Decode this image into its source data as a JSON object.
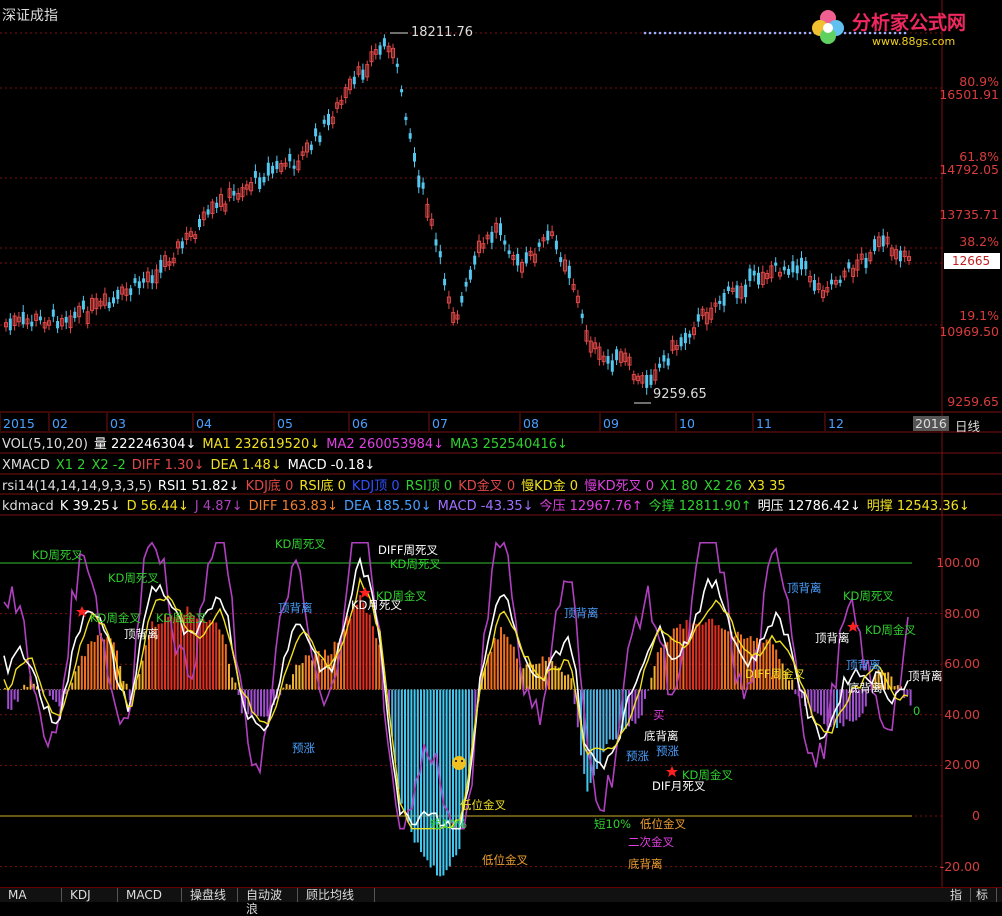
{
  "title": "深证成指",
  "logo": {
    "brand": "分析家公式网",
    "url_text": "www.88gs.com"
  },
  "colors": {
    "up": "#e04848",
    "down": "#55c8f0",
    "grid": "#7a1010",
    "axis_text": "#d83c3c",
    "date_text": "#4aa0ff",
    "white": "#ffffff",
    "yellow": "#f0e020",
    "magenta": "#b040c0",
    "green": "#30c030"
  },
  "price_axis": [
    "80.9%",
    "16501.91",
    "61.8%",
    "14792.05",
    "13735.71",
    "38.2%",
    "12679.5",
    "19.1%",
    "10969.50",
    "9259.65"
  ],
  "price_marker": "12665",
  "high_label": "18211.76",
  "low_label": "9259.65",
  "dates": [
    "2015",
    "02",
    "03",
    "04",
    "05",
    "06",
    "07",
    "08",
    "09",
    "10",
    "11",
    "12",
    "2016",
    "日线"
  ],
  "indicators": {
    "vol": [
      {
        "t": "VOL(5,10,20)",
        "c": "#dddddd"
      },
      {
        "t": "量 222246304↓",
        "c": "#ffffff"
      },
      {
        "t": "MA1 232619520↓",
        "c": "#f0e020"
      },
      {
        "t": "MA2 260053984↓",
        "c": "#e040e0"
      },
      {
        "t": "MA3 252540416↓",
        "c": "#30d030"
      }
    ],
    "xmacd": [
      {
        "t": "XMACD",
        "c": "#dddddd"
      },
      {
        "t": "X1 2",
        "c": "#30d030"
      },
      {
        "t": "X2 -2",
        "c": "#30d030"
      },
      {
        "t": "DIFF 1.30↓",
        "c": "#e04848"
      },
      {
        "t": "DEA 1.48↓",
        "c": "#f0e020"
      },
      {
        "t": "MACD -0.18↓",
        "c": "#ffffff"
      }
    ],
    "rsi": [
      {
        "t": "rsi14(14,14,14,9,3,3,5)",
        "c": "#dddddd"
      },
      {
        "t": "RSI1 51.82↓",
        "c": "#ffffff"
      },
      {
        "t": "KDJ底 0",
        "c": "#e04848"
      },
      {
        "t": "RSI底 0",
        "c": "#f0e020"
      },
      {
        "t": "KDJ顶 0",
        "c": "#3050ff"
      },
      {
        "t": "RSI顶 0",
        "c": "#30d030"
      },
      {
        "t": "KD金叉 0",
        "c": "#e04848"
      },
      {
        "t": "慢KD金 0",
        "c": "#f0e020"
      },
      {
        "t": "慢KD死叉 0",
        "c": "#e040e0"
      },
      {
        "t": "X1 80",
        "c": "#30d030"
      },
      {
        "t": "X2 26",
        "c": "#30d030"
      },
      {
        "t": "X3 35",
        "c": "#f0e020"
      }
    ],
    "kdmacd": [
      {
        "t": "kdmacd",
        "c": "#dddddd"
      },
      {
        "t": "K 39.25↓",
        "c": "#ffffff"
      },
      {
        "t": "D 56.44↓",
        "c": "#f0e020"
      },
      {
        "t": "J 4.87↓",
        "c": "#b040c0"
      },
      {
        "t": "DIFF 163.83↓",
        "c": "#f08030"
      },
      {
        "t": "DEA 185.50↓",
        "c": "#4aa0ff"
      },
      {
        "t": "MACD -43.35↓",
        "c": "#a070ff"
      },
      {
        "t": "今压 12967.76↑",
        "c": "#e040e0"
      },
      {
        "t": "今撑 12811.90↑",
        "c": "#30d030"
      },
      {
        "t": "明压 12786.42↓",
        "c": "#ffffff"
      },
      {
        "t": "明撑 12543.36↓",
        "c": "#f0e020"
      }
    ]
  },
  "osc_axis": [
    "100.00",
    "80.00",
    "60.00",
    "40.00",
    "20.00",
    "0",
    "-20.00"
  ],
  "annotations": [
    {
      "t": "KD周死叉",
      "c": "#30d030"
    },
    {
      "t": "KD周死叉",
      "c": "#30d030"
    },
    {
      "t": "KD周死叉",
      "c": "#30d030"
    },
    {
      "t": "DIFF周死叉",
      "c": "#ffffff"
    },
    {
      "t": "KD周死叉",
      "c": "#30d030"
    },
    {
      "t": "KD周金叉",
      "c": "#30d030"
    },
    {
      "t": "KD周金叉",
      "c": "#30d030"
    },
    {
      "t": "顶背离",
      "c": "#ffffff"
    },
    {
      "t": "顶背离",
      "c": "#4aa0ff"
    },
    {
      "t": "KD月死叉",
      "c": "#ffffff"
    },
    {
      "t": "KD周金叉",
      "c": "#30d030"
    },
    {
      "t": "顶背离",
      "c": "#4aa0ff"
    },
    {
      "t": "顶背离",
      "c": "#4aa0ff"
    },
    {
      "t": "KD周死叉",
      "c": "#30d030"
    },
    {
      "t": "顶背离",
      "c": "#ffffff"
    },
    {
      "t": "KD周金叉",
      "c": "#30d030"
    },
    {
      "t": "顶背离",
      "c": "#4aa0ff"
    },
    {
      "t": "DIFF周金叉",
      "c": "#f0e020"
    },
    {
      "t": "底背离",
      "c": "#ffffff"
    },
    {
      "t": "顶背离",
      "c": "#ffffff"
    },
    {
      "t": "预涨",
      "c": "#4aa0ff"
    },
    {
      "t": "底背离",
      "c": "#ffffff"
    },
    {
      "t": "预涨",
      "c": "#4aa0ff"
    },
    {
      "t": "预涨",
      "c": "#4aa0ff"
    },
    {
      "t": "KD周金叉",
      "c": "#30d030"
    },
    {
      "t": "DIF月死叉",
      "c": "#ffffff"
    },
    {
      "t": "低位金叉",
      "c": "#f0e020"
    },
    {
      "t": "短10%",
      "c": "#30d030"
    },
    {
      "t": "短10%",
      "c": "#30d030"
    },
    {
      "t": "低位金叉",
      "c": "#f0a030"
    },
    {
      "t": "低位金叉",
      "c": "#f0a030"
    },
    {
      "t": "二次金叉",
      "c": "#e040e0"
    },
    {
      "t": "底背离",
      "c": "#f0a030"
    },
    {
      "t": "买",
      "c": "#e040e0"
    },
    {
      "t": "0",
      "c": "#30d030"
    }
  ],
  "tabs": [
    "MA",
    "KDJ",
    "MACD",
    "操盘线",
    "自动波浪",
    "顾比均线",
    "指",
    "标"
  ]
}
